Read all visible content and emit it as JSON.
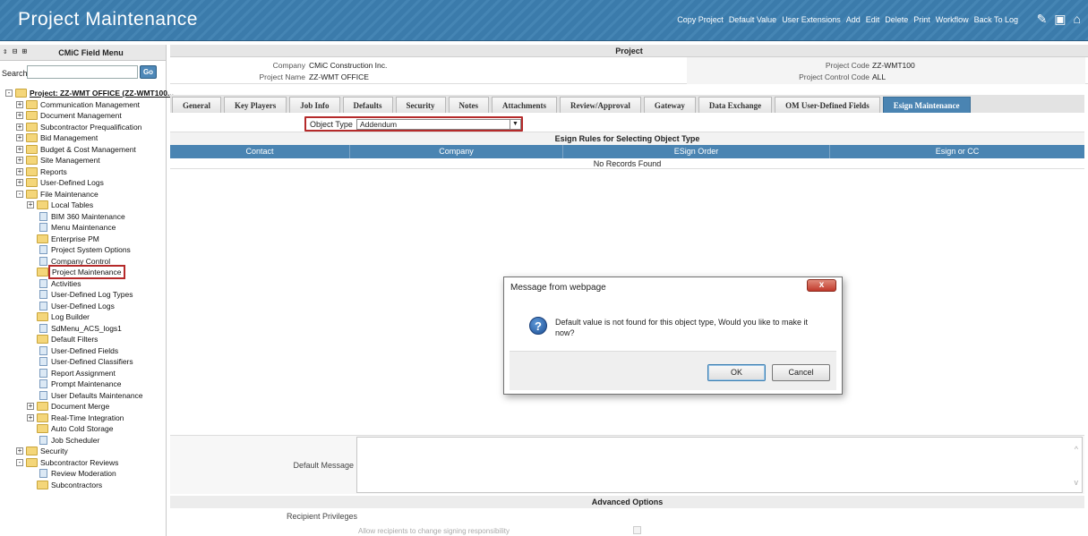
{
  "header": {
    "title": "Project Maintenance",
    "toolbar": [
      "Copy Project",
      "Default Value",
      "User Extensions",
      "Add",
      "Edit",
      "Delete",
      "Print",
      "Workflow",
      "Back To Log"
    ],
    "icons": [
      "edit-note-icon",
      "calendar-icon",
      "home-icon"
    ]
  },
  "sidebar": {
    "title": "CMiC Field Menu",
    "controls": "⇕ ⊟ ⊞",
    "search_label": "Search",
    "go_label": "Go",
    "tree": [
      {
        "label": "Project: ZZ-WMT OFFICE (ZZ-WMT100...",
        "level": 0,
        "type": "folder",
        "exp": "-",
        "root": true
      },
      {
        "label": "Communication Management",
        "level": 1,
        "type": "folder",
        "exp": "+"
      },
      {
        "label": "Document Management",
        "level": 1,
        "type": "folder",
        "exp": "+"
      },
      {
        "label": "Subcontractor Prequalification",
        "level": 1,
        "type": "folder",
        "exp": "+"
      },
      {
        "label": "Bid Management",
        "level": 1,
        "type": "folder",
        "exp": "+"
      },
      {
        "label": "Budget & Cost Management",
        "level": 1,
        "type": "folder",
        "exp": "+"
      },
      {
        "label": "Site Management",
        "level": 1,
        "type": "folder",
        "exp": "+"
      },
      {
        "label": "Reports",
        "level": 1,
        "type": "folder",
        "exp": "+"
      },
      {
        "label": "User-Defined Logs",
        "level": 1,
        "type": "folder",
        "exp": "+"
      },
      {
        "label": "File Maintenance",
        "level": 1,
        "type": "folder",
        "exp": "-"
      },
      {
        "label": "Local Tables",
        "level": 2,
        "type": "folder",
        "exp": "+"
      },
      {
        "label": "BIM 360 Maintenance",
        "level": 2,
        "type": "page"
      },
      {
        "label": "Menu Maintenance",
        "level": 2,
        "type": "page"
      },
      {
        "label": "Enterprise PM",
        "level": 2,
        "type": "folder"
      },
      {
        "label": "Project System Options",
        "level": 2,
        "type": "page"
      },
      {
        "label": "Company Control",
        "level": 2,
        "type": "page"
      },
      {
        "label": "Project Maintenance",
        "level": 2,
        "type": "folder",
        "highlight": true
      },
      {
        "label": "Activities",
        "level": 2,
        "type": "page"
      },
      {
        "label": "User-Defined Log Types",
        "level": 2,
        "type": "page"
      },
      {
        "label": "User-Defined Logs",
        "level": 2,
        "type": "page"
      },
      {
        "label": "Log Builder",
        "level": 2,
        "type": "folder"
      },
      {
        "label": "SdMenu_ACS_logs1",
        "level": 2,
        "type": "page"
      },
      {
        "label": "Default Filters",
        "level": 2,
        "type": "folder"
      },
      {
        "label": "User-Defined Fields",
        "level": 2,
        "type": "page"
      },
      {
        "label": "User-Defined Classifiers",
        "level": 2,
        "type": "page"
      },
      {
        "label": "Report Assignment",
        "level": 2,
        "type": "page"
      },
      {
        "label": "Prompt Maintenance",
        "level": 2,
        "type": "page"
      },
      {
        "label": "User Defaults Maintenance",
        "level": 2,
        "type": "page"
      },
      {
        "label": "Document Merge",
        "level": 2,
        "type": "folder",
        "exp": "+"
      },
      {
        "label": "Real-Time Integration",
        "level": 2,
        "type": "folder",
        "exp": "+"
      },
      {
        "label": "Auto Cold Storage",
        "level": 2,
        "type": "folder"
      },
      {
        "label": "Job Scheduler",
        "level": 2,
        "type": "page"
      },
      {
        "label": "Security",
        "level": 1,
        "type": "folder",
        "exp": "+"
      },
      {
        "label": "Subcontractor Reviews",
        "level": 1,
        "type": "folder",
        "exp": "-"
      },
      {
        "label": "Review Moderation",
        "level": 2,
        "type": "page"
      },
      {
        "label": "Subcontractors",
        "level": 2,
        "type": "folder"
      }
    ]
  },
  "main": {
    "section_title": "Project",
    "company_label": "Company",
    "company_value": "CMiC Construction Inc.",
    "project_name_label": "Project Name",
    "project_name_value": "ZZ-WMT OFFICE",
    "project_code_label": "Project Code",
    "project_code_value": "ZZ-WMT100",
    "project_control_label": "Project Control Code",
    "project_control_value": "ALL",
    "tabs": [
      {
        "label": "General"
      },
      {
        "label": "Key Players"
      },
      {
        "label": "Job Info"
      },
      {
        "label": "Defaults"
      },
      {
        "label": "Security"
      },
      {
        "label": "Notes"
      },
      {
        "label": "Attachments"
      },
      {
        "label": "Review/Approval"
      },
      {
        "label": "Gateway"
      },
      {
        "label": "Data Exchange"
      },
      {
        "label": "OM User-Defined Fields"
      },
      {
        "label": "Esign Maintenance",
        "active": true
      }
    ],
    "object_type_label": "Object Type",
    "object_type_value": "Addendum",
    "rules_title": "Esign Rules for Selecting Object Type",
    "columns": [
      "Contact",
      "Company",
      "ESign Order",
      "Esign or CC"
    ],
    "no_records": "No Records Found",
    "default_message_label": "Default Message",
    "advanced_title": "Advanced Options",
    "recipient_privileges_label": "Recipient Privileges",
    "allow_change_label": "Allow recipients to change signing responsibility"
  },
  "dialog": {
    "title": "Message from webpage",
    "close": "x",
    "icon": "?",
    "message": "Default value is not found for this object type, Would you like to make it now?",
    "ok": "OK",
    "cancel": "Cancel"
  }
}
